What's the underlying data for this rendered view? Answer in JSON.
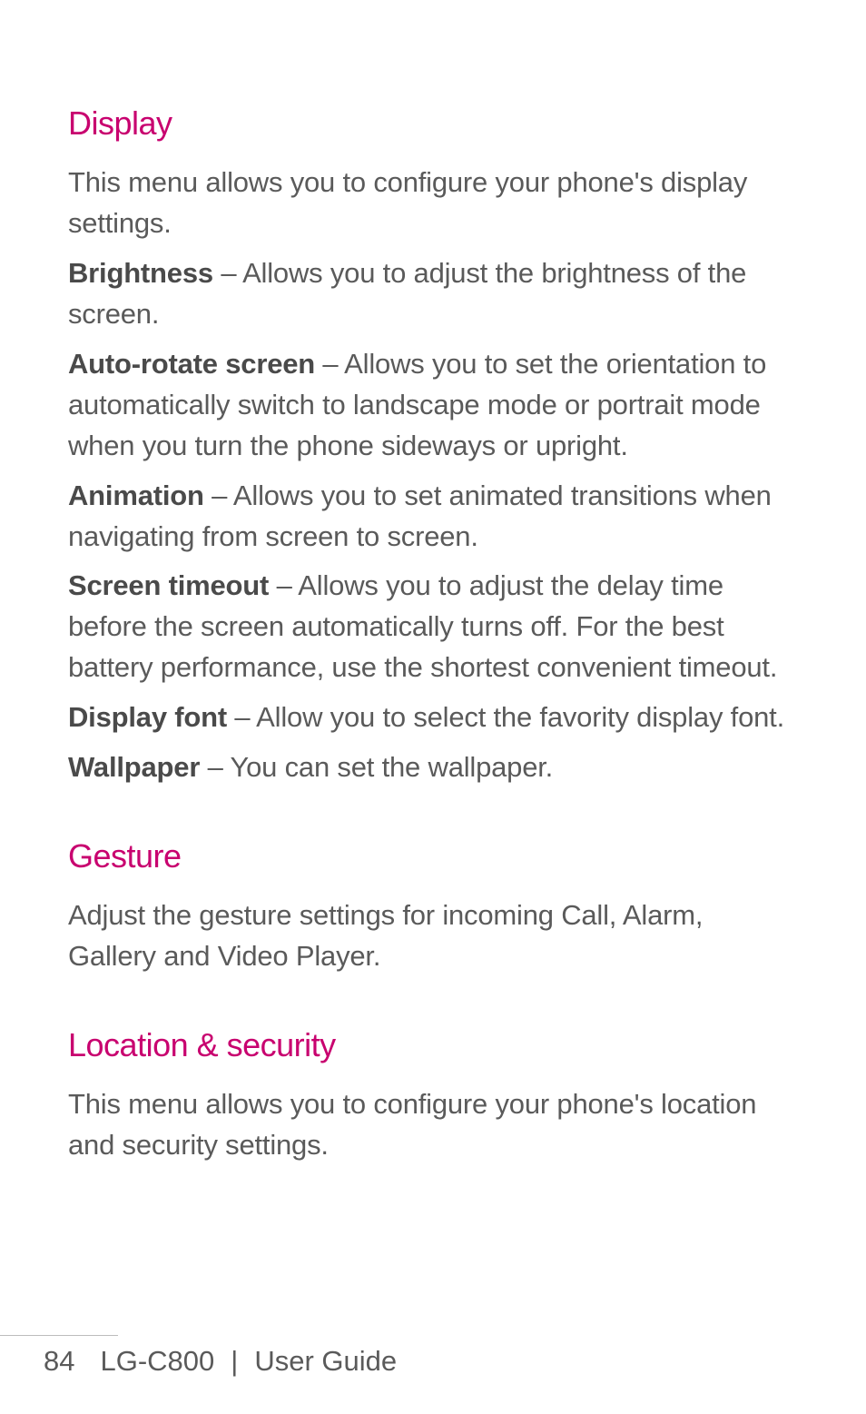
{
  "sections": [
    {
      "heading": "Display",
      "paragraphs": [
        {
          "term": null,
          "text": "This menu allows you to configure your phone's display settings."
        },
        {
          "term": "Brightness",
          "text": " – Allows you to adjust the brightness of the screen."
        },
        {
          "term": "Auto-rotate screen",
          "text": " – Allows you to set the orientation to automatically switch to landscape mode or portrait mode when you turn the phone sideways or upright."
        },
        {
          "term": "Animation",
          "text": " – Allows you to set animated transitions when navigating from screen to screen."
        },
        {
          "term": "Screen timeout",
          "text": " – Allows you to adjust the delay time before the screen automatically turns off. For the best battery performance, use the shortest convenient timeout."
        },
        {
          "term": "Display font",
          "text": " – Allow you to select the favority display font."
        },
        {
          "term": "Wallpaper",
          "text": " – You can set the wallpaper."
        }
      ]
    },
    {
      "heading": "Gesture",
      "paragraphs": [
        {
          "term": null,
          "text": "Adjust the gesture settings for incoming Call, Alarm, Gallery and Video Player."
        }
      ]
    },
    {
      "heading": "Location & security",
      "paragraphs": [
        {
          "term": null,
          "text": "This menu allows you to configure your phone's location and security settings."
        }
      ]
    }
  ],
  "footer": {
    "page_number": "84",
    "model": "LG-C800",
    "separator": "|",
    "doc_title": "User Guide"
  }
}
